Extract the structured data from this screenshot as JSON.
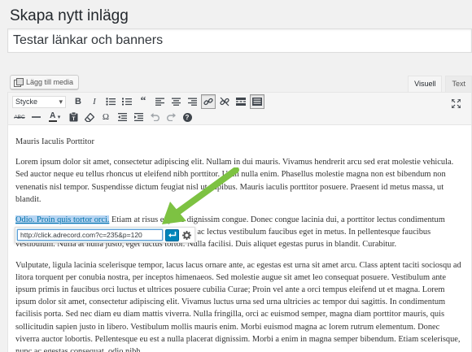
{
  "page": {
    "title": "Skapa nytt inlägg"
  },
  "post": {
    "title": "Testar länkar och banners"
  },
  "media": {
    "add_label": "Lägg till media"
  },
  "tabs": [
    {
      "label": "Visuell",
      "active": true
    },
    {
      "label": "Text",
      "active": false
    }
  ],
  "toolbar": {
    "format_select": "Stycke",
    "row1": [
      "bold",
      "italic",
      "bulleted-list",
      "numbered-list",
      "blockquote",
      "align-left",
      "align-center",
      "align-right",
      "link",
      "unlink",
      "read-more",
      "toolbar-toggle"
    ],
    "row2": [
      "strikethrough",
      "horizontal-line",
      "text-color",
      "paste-as-text",
      "clear-formatting",
      "special-character",
      "outdent",
      "indent",
      "undo",
      "redo",
      "help"
    ],
    "text_color_label": "A",
    "strike_label": "ABC",
    "bold_label": "B",
    "italic_label": "I",
    "special_char_label": "Ω",
    "help_label": "?"
  },
  "content": {
    "p1": "Mauris Iaculis Porttitor",
    "p2": "Lorem ipsum dolor sit amet, consectetur adipiscing elit. Nullam in dui mauris. Vivamus hendrerit arcu sed erat molestie vehicula. Sed auctor neque eu tellus rhoncus ut eleifend nibh porttitor. Ut in nulla enim. Phasellus molestie magna non est bibendum non venenatis nisl tempor. Suspendisse dictum feugiat nisl ut dapibus. Mauris iaculis porttitor posuere. Praesent id metus massa, ut blandit.",
    "p3_link": "Odio. Proin quis tortor orci.",
    "p3_rest_line1": " Etiam at risus et justo dignissim congue. Donec congue lacinia dui, a porttitor lectus condimentum",
    "p3_line2": "laoreet. Nunc eu ullamcorper orci. Quisque eget odio ac lectus vestibulum faucibus eget in metus. In pellentesque faucibus",
    "p3_line3": "vestibulum. Nulla at nulla justo, eget luctus tortor. Nulla facilisi. Duis aliquet egestas purus in blandit. Curabitur.",
    "p4": "Vulputate, ligula lacinia scelerisque tempor, lacus lacus ornare ante, ac egestas est urna sit amet arcu. Class aptent taciti sociosqu ad litora torquent per conubia nostra, per inceptos himenaeos. Sed molestie augue sit amet leo consequat posuere. Vestibulum ante ipsum primis in faucibus orci luctus et ultrices posuere cubilia Curae; Proin vel ante a orci tempus eleifend ut et magna. Lorem ipsum dolor sit amet, consectetur adipiscing elit. Vivamus luctus urna sed urna ultricies ac tempor dui sagittis. In condimentum facilisis porta. Sed nec diam eu diam mattis viverra. Nulla fringilla, orci ac euismod semper, magna diam porttitor mauris, quis sollicitudin sapien justo in libero. Vestibulum mollis mauris enim. Morbi euismod magna ac lorem rutrum elementum. Donec viverra auctor lobortis. Pellentesque eu est a nulla placerat dignissim. Morbi a enim in magna semper bibendum. Etiam scelerisque, nunc ac egestas consequat, odio nibh."
  },
  "link_popup": {
    "url": "http://click.adrecord.com?c=235&p=120"
  },
  "colors": {
    "accent": "#0085ba",
    "arrow": "#7dc242",
    "selection": "#b6d4f2"
  }
}
